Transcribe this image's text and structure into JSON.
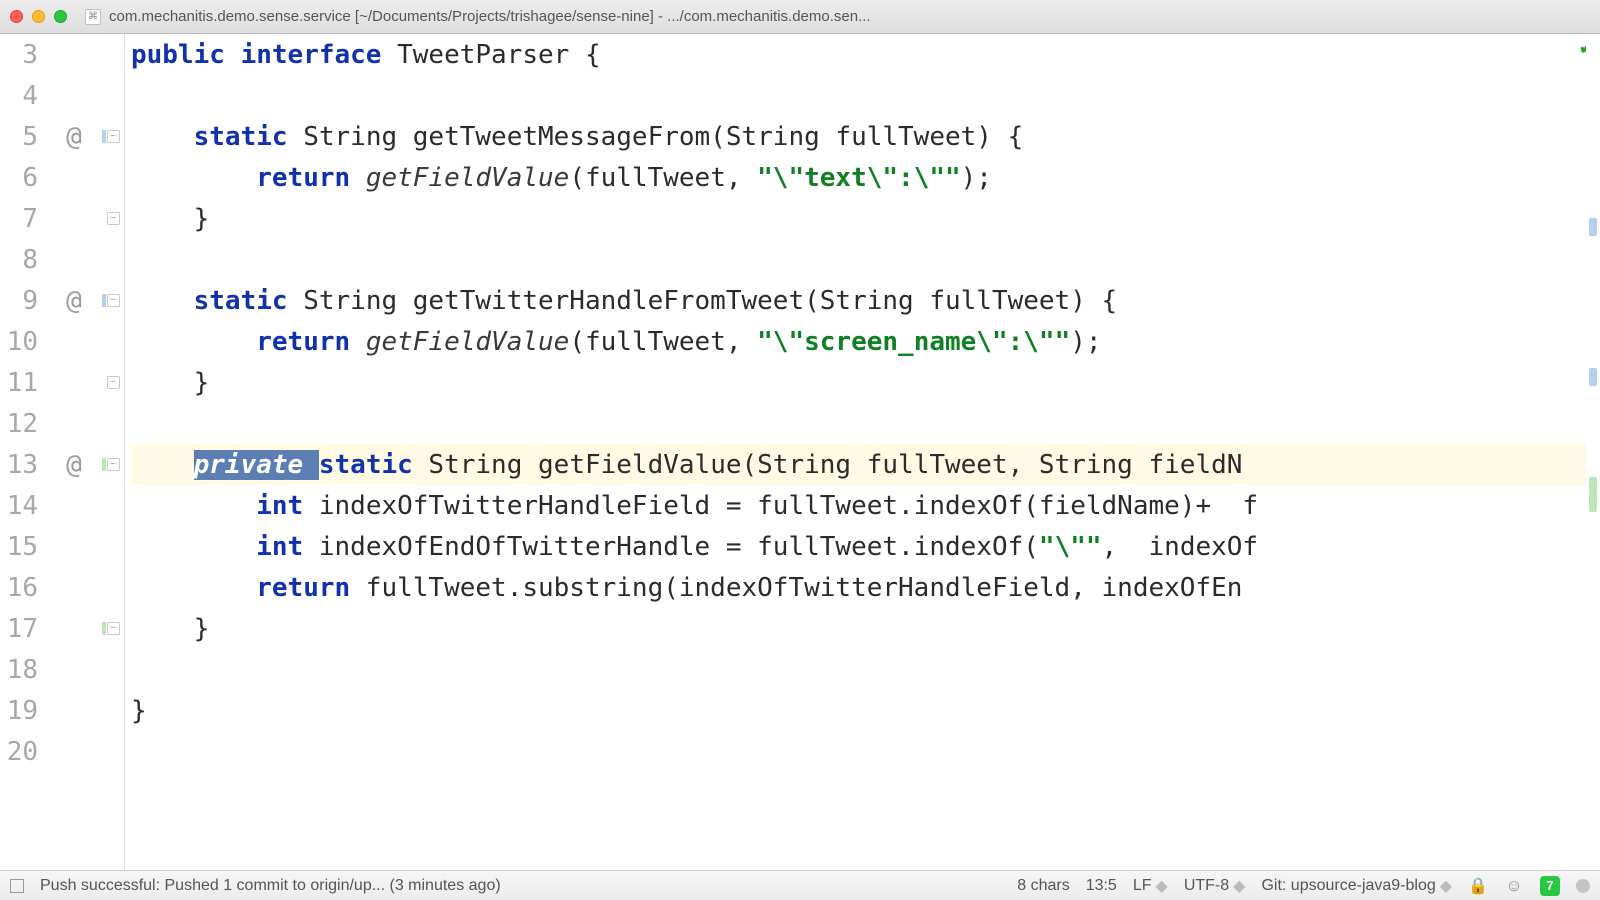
{
  "window": {
    "title": "com.mechanitis.demo.sense.service [~/Documents/Projects/trishagee/sense-nine] - .../com.mechanitis.demo.sen..."
  },
  "editor": {
    "first_line_number": 3,
    "highlighted_line": 13,
    "selection": {
      "text": "private ",
      "line": 13
    },
    "has_intention_bulb_on_line": 13,
    "analysis_ok": true,
    "gutter": [
      {
        "n": 3
      },
      {
        "n": 4
      },
      {
        "n": 5,
        "ann": "@",
        "fold": "down",
        "tick": "blue"
      },
      {
        "n": 6,
        "tick": "blue"
      },
      {
        "n": 7,
        "fold": "up"
      },
      {
        "n": 8
      },
      {
        "n": 9,
        "ann": "@",
        "fold": "down",
        "tick": "blue"
      },
      {
        "n": 10,
        "tick": "blue"
      },
      {
        "n": 11,
        "fold": "up"
      },
      {
        "n": 12,
        "tick": "green"
      },
      {
        "n": 13,
        "ann": "@",
        "fold": "down",
        "tick": "green"
      },
      {
        "n": 14,
        "tick": "green"
      },
      {
        "n": 15,
        "tick": "green"
      },
      {
        "n": 16,
        "tick": "green"
      },
      {
        "n": 17,
        "fold": "up",
        "tick": "green"
      },
      {
        "n": 18
      },
      {
        "n": 19
      },
      {
        "n": 20
      }
    ],
    "tokens": {
      "l3": [
        [
          "kw",
          "public"
        ],
        [
          "",
          " "
        ],
        [
          "kw",
          "interface"
        ],
        [
          "",
          " TweetParser {"
        ]
      ],
      "l4": [
        [
          "",
          ""
        ]
      ],
      "l5": [
        [
          "",
          "    "
        ],
        [
          "kw",
          "static"
        ],
        [
          "",
          " String getTweetMessageFrom(String fullTweet) {"
        ]
      ],
      "l6": [
        [
          "",
          "        "
        ],
        [
          "kw",
          "return"
        ],
        [
          "",
          " "
        ],
        [
          "call-i",
          "getFieldValue"
        ],
        [
          "",
          "(fullTweet, "
        ],
        [
          "str",
          "\"\\\"text\\\":\\\"\""
        ],
        [
          "",
          ");"
        ]
      ],
      "l7": [
        [
          "",
          "    }"
        ]
      ],
      "l8": [
        [
          "",
          ""
        ]
      ],
      "l9": [
        [
          "",
          "    "
        ],
        [
          "kw",
          "static"
        ],
        [
          "",
          " String getTwitterHandleFromTweet(String fullTweet) {"
        ]
      ],
      "l10": [
        [
          "",
          "        "
        ],
        [
          "kw",
          "return"
        ],
        [
          "",
          " "
        ],
        [
          "call-i",
          "getFieldValue"
        ],
        [
          "",
          "(fullTweet, "
        ],
        [
          "str",
          "\"\\\"screen_name\\\":\\\"\""
        ],
        [
          "",
          ");"
        ]
      ],
      "l11": [
        [
          "",
          "    }"
        ]
      ],
      "l12": [
        [
          "",
          ""
        ]
      ],
      "l13": [
        [
          "",
          "    "
        ],
        [
          "sel-kw-i",
          "private "
        ],
        [
          "kw",
          "static"
        ],
        [
          "",
          " String getFieldValue(String fullTweet, String fieldN"
        ]
      ],
      "l14": [
        [
          "",
          "        "
        ],
        [
          "kw",
          "int"
        ],
        [
          "",
          " indexOfTwitterHandleField = fullTweet.indexOf(fieldName)+  f"
        ]
      ],
      "l15": [
        [
          "",
          "        "
        ],
        [
          "kw",
          "int"
        ],
        [
          "",
          " indexOfEndOfTwitterHandle = fullTweet.indexOf("
        ],
        [
          "str",
          "\"\\\"\""
        ],
        [
          "",
          ",  indexOf"
        ]
      ],
      "l16": [
        [
          "",
          "        "
        ],
        [
          "kw",
          "return"
        ],
        [
          "",
          " fullTweet.substring(indexOfTwitterHandleField, indexOfEn"
        ]
      ],
      "l17": [
        [
          "",
          "    }"
        ]
      ],
      "l18": [
        [
          "",
          ""
        ]
      ],
      "l19": [
        [
          "",
          "}"
        ]
      ],
      "l20": [
        [
          "",
          ""
        ]
      ]
    },
    "overview_marks": [
      {
        "top_pct": 22,
        "color": "#b4d0ee"
      },
      {
        "top_pct": 40,
        "color": "#b4d0ee"
      },
      {
        "top_pct": 53,
        "color": "#bfe4bb"
      },
      {
        "top_pct": 55,
        "color": "#bfe4bb"
      }
    ]
  },
  "statusbar": {
    "message": "Push successful: Pushed 1 commit to origin/up... (3 minutes ago)",
    "selection_info": "8 chars",
    "caret": "13:5",
    "line_sep": "LF",
    "encoding": "UTF-8",
    "git_label": "Git: upsource-java9-blog",
    "notifications_count": "7"
  }
}
